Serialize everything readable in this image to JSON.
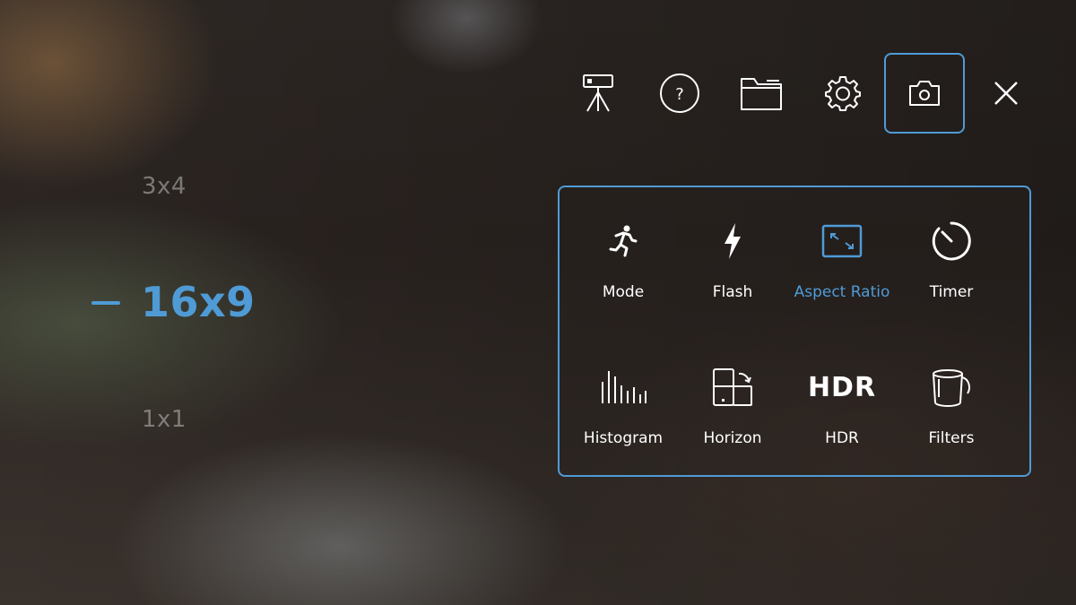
{
  "aspect_ratio_picker": {
    "options": [
      "3x4",
      "16x9",
      "1x1"
    ],
    "selected": "16x9"
  },
  "toolbar": {
    "buttons": [
      {
        "icon": "tripod-icon",
        "label": ""
      },
      {
        "icon": "help-icon",
        "label": "?"
      },
      {
        "icon": "folder-icon",
        "label": ""
      },
      {
        "icon": "gear-icon",
        "label": ""
      },
      {
        "icon": "camera-icon",
        "label": "",
        "active": true
      },
      {
        "icon": "close-icon",
        "label": ""
      }
    ]
  },
  "settings_panel": {
    "tiles": [
      {
        "label": "Mode",
        "icon": "running-person-icon"
      },
      {
        "label": "Flash",
        "icon": "lightning-icon"
      },
      {
        "label": "Aspect Ratio",
        "icon": "aspect-ratio-icon",
        "selected": true
      },
      {
        "label": "Timer",
        "icon": "timer-icon"
      },
      {
        "label": "Histogram",
        "icon": "histogram-icon"
      },
      {
        "label": "Horizon",
        "icon": "horizon-icon"
      },
      {
        "label": "HDR",
        "icon": "hdr-icon",
        "icon_text": "HDR"
      },
      {
        "label": "Filters",
        "icon": "paint-bucket-icon"
      }
    ]
  },
  "colors": {
    "accent": "#4f9bd6",
    "text": "#ffffff",
    "dim_text": "#bebebe"
  }
}
